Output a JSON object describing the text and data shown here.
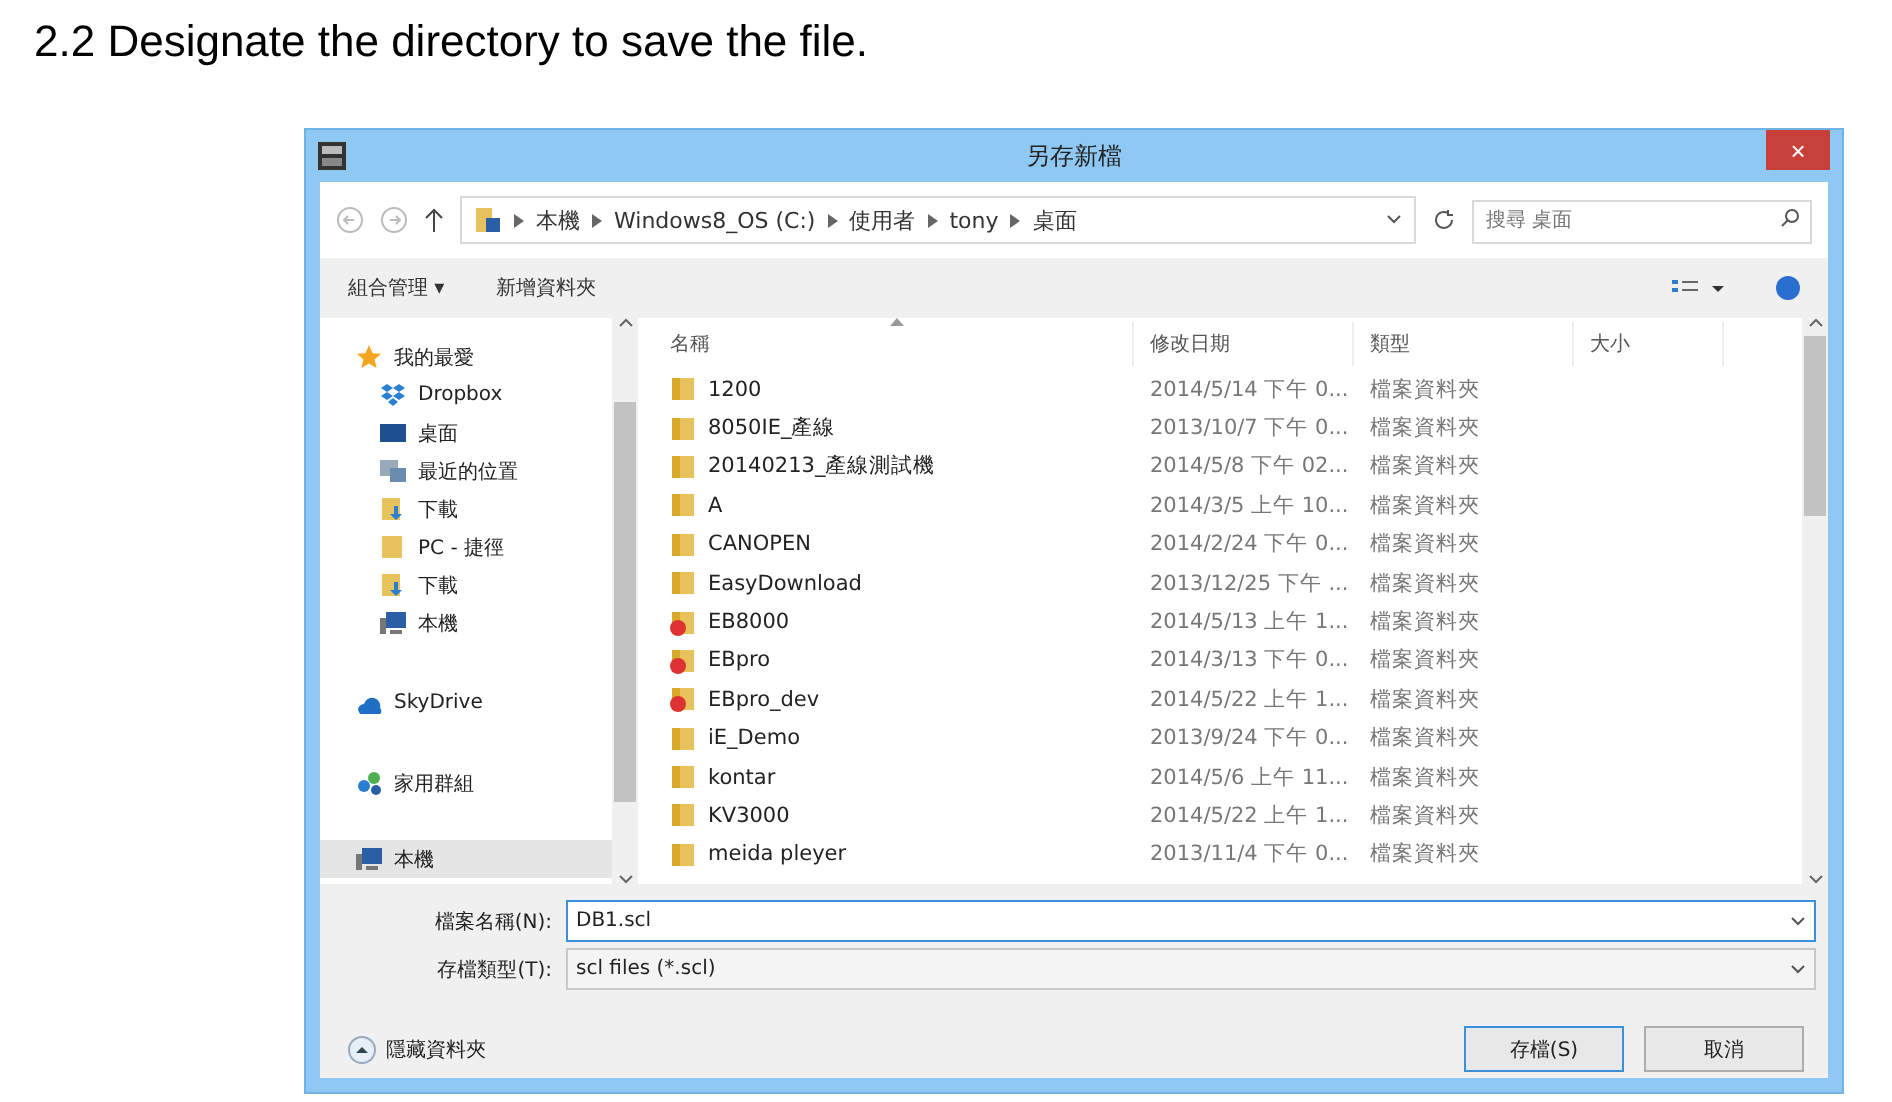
{
  "heading": "2.2 Designate the directory to save the file.",
  "window": {
    "title": "另存新檔",
    "close": "×"
  },
  "address": {
    "crumbs": [
      "本機",
      "Windows8_OS (C:)",
      "使用者",
      "tony",
      "桌面"
    ],
    "search_placeholder": "搜尋 桌面"
  },
  "toolbar": {
    "organize": "組合管理 ▾",
    "new_folder": "新增資料夾"
  },
  "nav": [
    {
      "label": "我的最愛",
      "kind": "star",
      "selected": false,
      "children": [
        {
          "label": "Dropbox",
          "kind": "dropbox",
          "selected": false
        },
        {
          "label": "桌面",
          "kind": "desktop",
          "selected": false
        },
        {
          "label": "最近的位置",
          "kind": "recent",
          "selected": false
        },
        {
          "label": "下載",
          "kind": "download",
          "selected": false
        },
        {
          "label": "PC - 捷徑",
          "kind": "folder",
          "selected": false
        },
        {
          "label": "下載",
          "kind": "download",
          "selected": false
        },
        {
          "label": "本機",
          "kind": "computer",
          "selected": false
        }
      ]
    },
    {
      "label": "SkyDrive",
      "kind": "cloud",
      "selected": false
    },
    {
      "label": "家用群組",
      "kind": "homegroup",
      "selected": false
    },
    {
      "label": "本機",
      "kind": "computer",
      "selected": true
    }
  ],
  "table": {
    "columns": [
      "名稱",
      "修改日期",
      "類型",
      "大小"
    ],
    "rows": [
      {
        "kind": "folder",
        "name": "1200",
        "date": "2014/5/14 下午 0...",
        "type": "檔案資料夾"
      },
      {
        "kind": "folder",
        "name": "8050IE_產線",
        "date": "2013/10/7 下午 0...",
        "type": "檔案資料夾"
      },
      {
        "kind": "folder",
        "name": "20140213_產線測試機",
        "date": "2014/5/8 下午 02...",
        "type": "檔案資料夾"
      },
      {
        "kind": "folder",
        "name": "A",
        "date": "2014/3/5 上午 10...",
        "type": "檔案資料夾"
      },
      {
        "kind": "folder",
        "name": "CANOPEN",
        "date": "2014/2/24 下午 0...",
        "type": "檔案資料夾"
      },
      {
        "kind": "folder",
        "name": "EasyDownload",
        "date": "2013/12/25 下午 ...",
        "type": "檔案資料夾"
      },
      {
        "kind": "alert",
        "name": "EB8000",
        "date": "2014/5/13 上午 1...",
        "type": "檔案資料夾"
      },
      {
        "kind": "alert",
        "name": "EBpro",
        "date": "2014/3/13 下午 0...",
        "type": "檔案資料夾"
      },
      {
        "kind": "alert",
        "name": "EBpro_dev",
        "date": "2014/5/22 上午 1...",
        "type": "檔案資料夾"
      },
      {
        "kind": "folder",
        "name": "iE_Demo",
        "date": "2013/9/24 下午 0...",
        "type": "檔案資料夾"
      },
      {
        "kind": "folder",
        "name": "kontar",
        "date": "2014/5/6 上午 11...",
        "type": "檔案資料夾"
      },
      {
        "kind": "folder",
        "name": "KV3000",
        "date": "2014/5/22 上午 1...",
        "type": "檔案資料夾"
      },
      {
        "kind": "folder",
        "name": "meida pleyer",
        "date": "2013/11/4 下午 0...",
        "type": "檔案資料夾"
      }
    ]
  },
  "form": {
    "filename_label": "檔案名稱(N):",
    "filename": "DB1.scl",
    "filetype_label": "存檔類型(T):",
    "filetype": "scl files (*.scl)"
  },
  "footer": {
    "hide_folders": "隱藏資料夾",
    "save": "存檔(S)",
    "cancel": "取消"
  }
}
